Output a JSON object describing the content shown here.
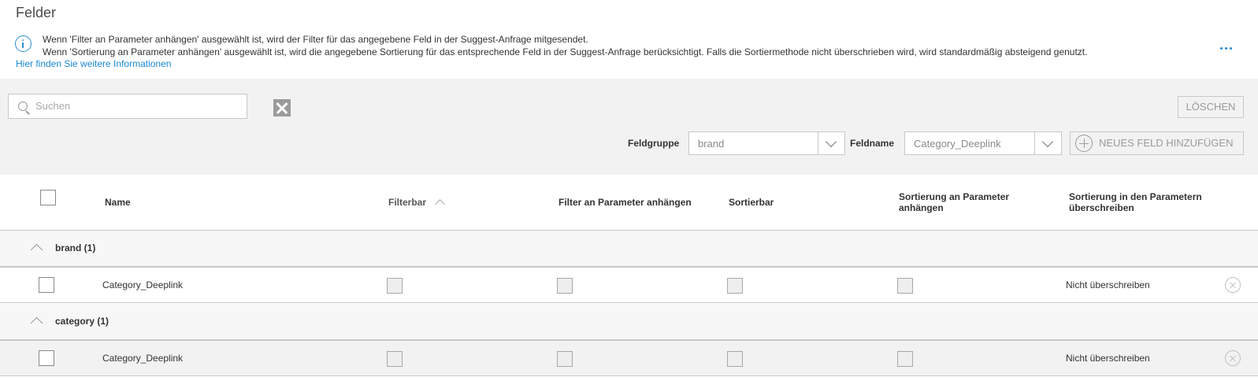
{
  "page": {
    "title": "Felder",
    "info_line1": "Wenn 'Filter an Parameter anhängen' ausgewählt ist, wird der Filter für das angegebene Feld in der Suggest-Anfrage mitgesendet.",
    "info_line2": "Wenn 'Sortierung an Parameter anhängen' ausgewählt ist, wird die angegebene Sortierung für das entsprechende Feld in der Suggest-Anfrage berücksichtigt. Falls die Sortiermethode nicht überschrieben wird, wird standardmäßig absteigend genutzt.",
    "info_link": "Hier finden Sie weitere Informationen",
    "more_icon": "more-horizontal-icon"
  },
  "toolbar": {
    "search_placeholder": "Suchen",
    "delete_label": "LÖSCHEN",
    "fieldgroup_label": "Feldgruppe",
    "fieldgroup_value": "brand",
    "fieldname_label": "Feldname",
    "fieldname_value": "Category_Deeplink",
    "add_field_label": "NEUES FELD HINZUFÜGEN"
  },
  "table": {
    "headers": {
      "name": "Name",
      "filterbar": "Filterbar",
      "filter_param": "Filter an Parameter anhängen",
      "sortierbar": "Sortierbar",
      "sort_param": "Sortierung an Parameter anhängen",
      "sort_overwrite": "Sortierung in den Parametern überschreiben"
    },
    "groups": [
      {
        "label": "brand (1)",
        "rows": [
          {
            "name": "Category_Deeplink",
            "overwrite": "Nicht überschreiben"
          }
        ]
      },
      {
        "label": "category (1)",
        "rows": [
          {
            "name": "Category_Deeplink",
            "overwrite": "Nicht überschreiben"
          }
        ]
      }
    ]
  },
  "colors": {
    "accent": "#1a87d4",
    "toolbar_bg": "#f2f2f2",
    "border": "#c8c8c8"
  }
}
